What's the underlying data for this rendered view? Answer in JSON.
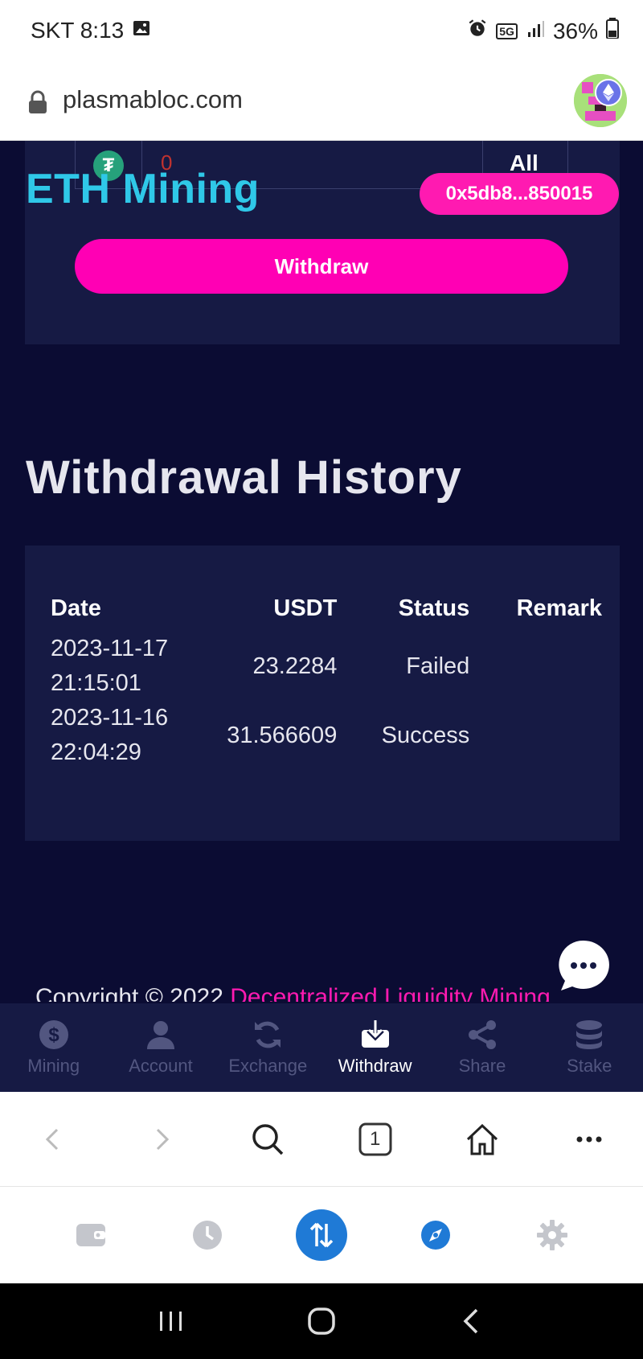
{
  "status_bar": {
    "carrier_time": "SKT 8:13",
    "network": "5G",
    "battery": "36%"
  },
  "browser": {
    "url": "plasmabloc.com"
  },
  "top_card": {
    "amount_placeholder": "0",
    "all_label": "All",
    "withdraw_label": "Withdraw"
  },
  "header": {
    "brand": "ETH Mining",
    "wallet": "0x5db8...850015"
  },
  "history": {
    "title": "Withdrawal History",
    "columns": [
      "Date",
      "USDT",
      "Status",
      "Remark"
    ],
    "rows": [
      {
        "date": "2023-11-17",
        "time": "21:15:01",
        "usdt": "23.2284",
        "status": "Failed",
        "remark": ""
      },
      {
        "date": "2023-11-16",
        "time": "22:04:29",
        "usdt": "31.566609",
        "status": "Success",
        "remark": ""
      }
    ]
  },
  "footer": {
    "copyright_prefix": "Copyright © 2022",
    "copyright_link": "Decentralized Liquidity Mining"
  },
  "tabs": [
    {
      "label": "Mining",
      "icon": "dollar-icon",
      "active": false
    },
    {
      "label": "Account",
      "icon": "user-icon",
      "active": false
    },
    {
      "label": "Exchange",
      "icon": "refresh-icon",
      "active": false
    },
    {
      "label": "Withdraw",
      "icon": "download-icon",
      "active": true
    },
    {
      "label": "Share",
      "icon": "share-icon",
      "active": false
    },
    {
      "label": "Stake",
      "icon": "database-icon",
      "active": false
    }
  ],
  "browser_toolbar": {
    "tab_count": "1"
  },
  "colors": {
    "accent_pink": "#ff00b4",
    "brand_cyan": "#2fc8e8",
    "bg": "#0b0c33",
    "card": "#161a44"
  }
}
